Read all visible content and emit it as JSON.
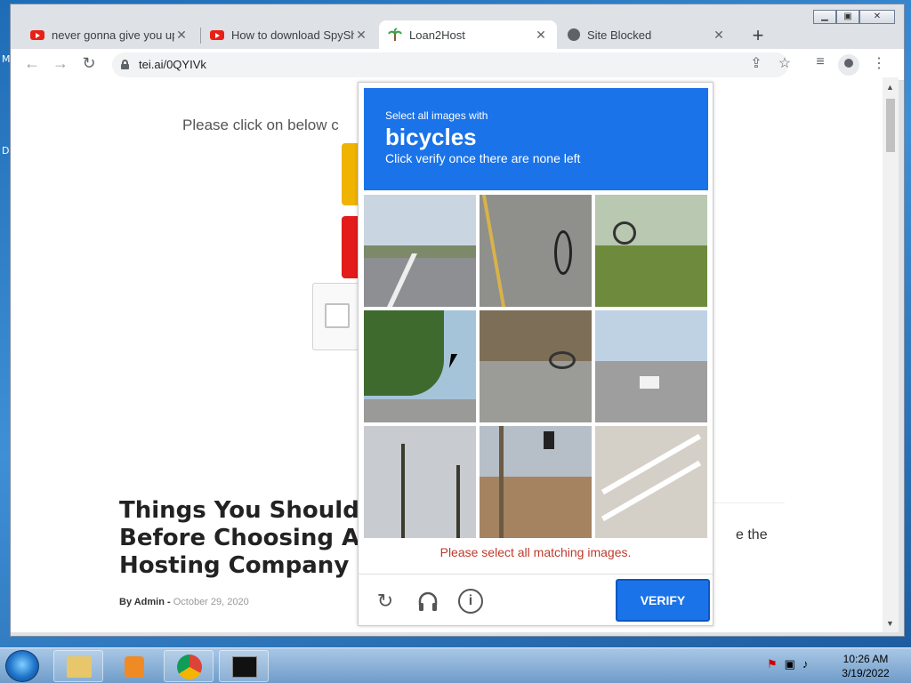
{
  "desktop": {
    "letters": [
      "M",
      "D"
    ]
  },
  "browser": {
    "tabs": [
      {
        "title": "never gonna give you up",
        "icon": "youtube-icon"
      },
      {
        "title": "How to download SpyShe",
        "icon": "youtube-icon"
      },
      {
        "title": "Loan2Host",
        "icon": "palm-icon"
      },
      {
        "title": "Site Blocked",
        "icon": "globe-icon"
      }
    ],
    "new_tab_label": "+",
    "url": "tei.ai/0QYIVk",
    "window_controls": {
      "minimize": "▁",
      "maximize": "▣",
      "close": "✕"
    }
  },
  "page": {
    "prompt_text": "Please click on below c",
    "article_title_lines": [
      "Things You Should",
      "Before Choosing A",
      "Hosting Company"
    ],
    "byline_author": "By Admin -",
    "byline_date": "October 29, 2020",
    "side_text": "e the"
  },
  "captcha": {
    "line1": "Select all images with",
    "keyword": "bicycles",
    "line3": "Click verify once there are none left",
    "tiles": [
      {
        "label": "road-with-bike-lane"
      },
      {
        "label": "parked-bicycle-on-street"
      },
      {
        "label": "cyclist-on-path"
      },
      {
        "label": "tree-lined-street"
      },
      {
        "label": "bicycles-on-sidewalk"
      },
      {
        "label": "intersection-with-cars"
      },
      {
        "label": "palm-trees"
      },
      {
        "label": "traffic-light-pole"
      },
      {
        "label": "building-stairs"
      }
    ],
    "error_message": "Please select all matching images.",
    "verify_label": "VERIFY"
  },
  "taskbar": {
    "time": "10:26 AM",
    "date": "3/19/2022"
  },
  "colors": {
    "captcha_blue": "#1a73e8",
    "error_red": "#c0392b"
  }
}
